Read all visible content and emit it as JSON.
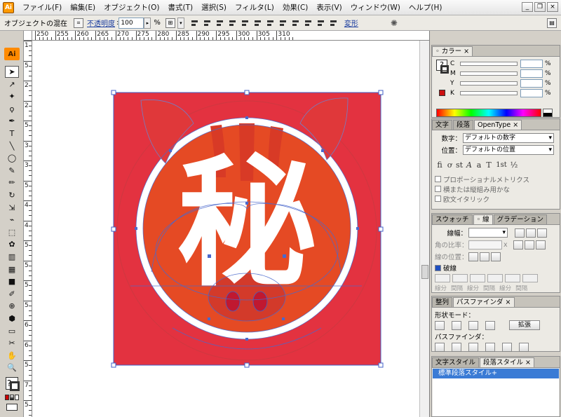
{
  "menu": {
    "items": [
      "ファイル(F)",
      "編集(E)",
      "オブジェクト(O)",
      "書式(T)",
      "選択(S)",
      "フィルタ(L)",
      "効果(C)",
      "表示(V)",
      "ウィンドウ(W)",
      "ヘルプ(H)"
    ]
  },
  "window_buttons": {
    "minimize": "_",
    "restore": "❐",
    "close": "×"
  },
  "control_bar": {
    "mode_label": "オブジェクトの混在",
    "opacity_label": "不透明度",
    "opacity_value": "100",
    "opacity_unit": "%",
    "transform_label": "変形"
  },
  "tools": {
    "logo": "Ai",
    "items": [
      "selection-tool",
      "direct-selection-tool",
      "magic-wand-tool",
      "lasso-tool",
      "pen-tool",
      "type-tool",
      "line-tool",
      "ellipse-tool",
      "paintbrush-tool",
      "pencil-tool",
      "rotate-tool",
      "scale-tool",
      "warp-tool",
      "free-transform-tool",
      "symbol-sprayer-tool",
      "graph-tool",
      "mesh-tool",
      "gradient-tool",
      "eyedropper-tool",
      "blend-tool",
      "live-paint-tool",
      "slice-tool",
      "scissors-tool",
      "hand-tool",
      "zoom-tool"
    ]
  },
  "rulers": {
    "horizontal": [
      "250",
      "255",
      "260",
      "265",
      "270",
      "275",
      "280",
      "285",
      "290",
      "295",
      "300",
      "305",
      "310"
    ],
    "vertical": [
      "1",
      "5",
      "2",
      "2",
      "5",
      "3",
      "3",
      "5",
      "4",
      "4",
      "5",
      "5",
      "5",
      "5",
      "6",
      "6",
      "5",
      "7",
      "5"
    ]
  },
  "color_panel": {
    "tab": "カラー",
    "channels": [
      {
        "label": "C",
        "unit": "%"
      },
      {
        "label": "M",
        "unit": "%"
      },
      {
        "label": "Y",
        "unit": "%"
      },
      {
        "label": "K",
        "unit": "%"
      }
    ],
    "fill_color": "#cc1010"
  },
  "character_panel": {
    "tabs": [
      "文字",
      "段落",
      "OpenType"
    ],
    "numeral_label": "数字：",
    "numeral_value": "デフォルトの数字",
    "position_label": "位置：",
    "position_value": "デフォルトの位置",
    "glyphs": [
      "fi",
      "ơ",
      "st",
      "A",
      "a",
      "T",
      "1st",
      "½"
    ],
    "options": [
      "プロポーショナルメトリクス",
      "横または縦組み用かな",
      "欧文イタリック"
    ]
  },
  "stroke_panel": {
    "tabs": [
      "スウォッチ",
      "線",
      "グラデーション"
    ],
    "width_label": "線幅：",
    "miter_label": "角の比率：",
    "miter_unit": "x",
    "align_label": "線の位置：",
    "dashed_label": "破線",
    "dash_labels": [
      "線分",
      "間隔",
      "線分",
      "間隔",
      "線分",
      "間隔"
    ]
  },
  "pathfinder_panel": {
    "tabs": [
      "整列",
      "パスファインダ"
    ],
    "shape_mode_label": "形状モード：",
    "expand_label": "拡張",
    "pathfinder_label": "パスファインダ："
  },
  "style_panel": {
    "tabs": [
      "文字スタイル",
      "段落スタイル"
    ],
    "items": [
      "標準段落スタイル+"
    ]
  },
  "artwork": {
    "glyph": "秘",
    "background_color": "#e33240",
    "circle_color": "#e54a24",
    "ring_color": "#ffffff",
    "selection_color": "#4060c8"
  }
}
